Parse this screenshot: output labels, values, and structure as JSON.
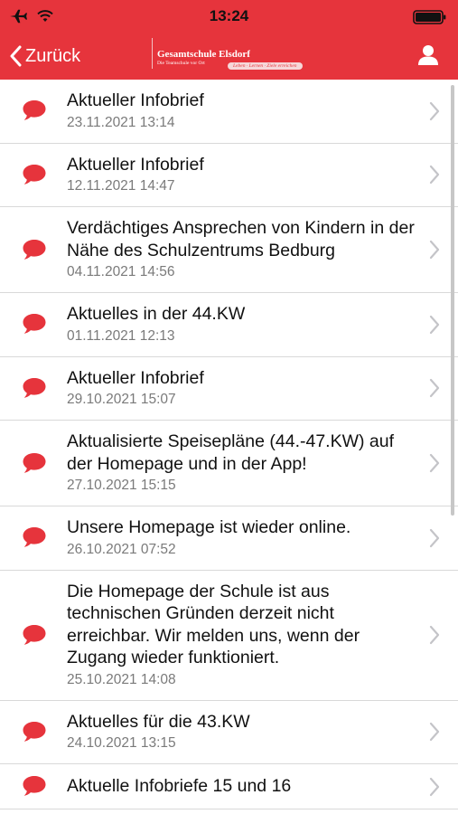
{
  "status": {
    "time": "13:24"
  },
  "nav": {
    "back_label": "Zurück",
    "logo_name": "Gesamtschule Elsdorf",
    "logo_sub": "Die Teamschule vor Ort",
    "logo_motto": "Leben · Lernen · Ziele erreichen"
  },
  "colors": {
    "accent": "#e6343c",
    "date": "#7a7a7a"
  },
  "icons": {
    "row": "speech-bubble-icon",
    "chevron": "chevron-right-icon",
    "user": "user-icon"
  },
  "items": [
    {
      "title": "Aktueller Infobrief",
      "date": "23.11.2021 13:14"
    },
    {
      "title": "Aktueller Infobrief",
      "date": "12.11.2021 14:47"
    },
    {
      "title": "Verdächtiges Ansprechen von Kindern in der Nähe des Schulzentrums Bedburg",
      "date": "04.11.2021 14:56"
    },
    {
      "title": "Aktuelles in der 44.KW",
      "date": "01.11.2021 12:13"
    },
    {
      "title": "Aktueller Infobrief",
      "date": "29.10.2021 15:07"
    },
    {
      "title": "Aktualisierte Speisepläne (44.-47.KW) auf der Homepage und in der App!",
      "date": "27.10.2021 15:15"
    },
    {
      "title": "Unsere Homepage ist wieder online.",
      "date": "26.10.2021 07:52"
    },
    {
      "title": "Die Homepage der Schule ist aus technischen Gründen derzeit nicht erreichbar. Wir melden uns, wenn der Zugang wieder funktioniert.",
      "date": "25.10.2021 14:08"
    },
    {
      "title": "Aktuelles für die 43.KW",
      "date": "24.10.2021 13:15"
    },
    {
      "title": "Aktuelle Infobriefe 15 und 16",
      "date": ""
    }
  ]
}
